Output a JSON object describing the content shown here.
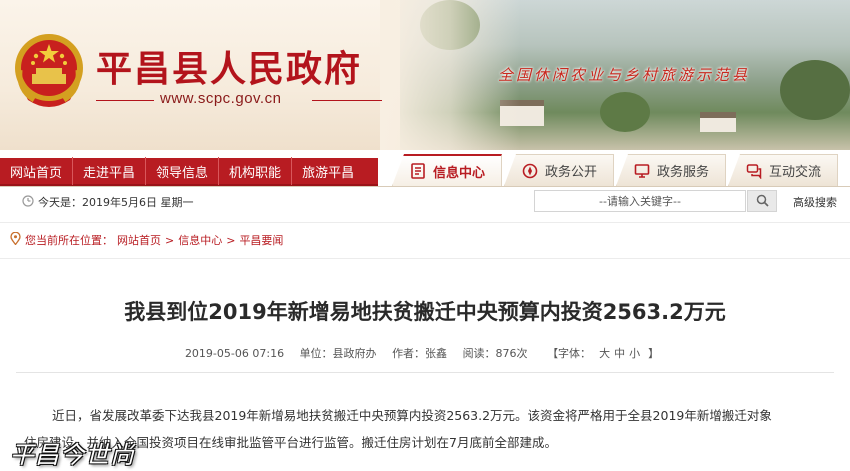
{
  "site": {
    "title": "平昌县人民政府",
    "url": "www.scpc.gov.cn",
    "slogan": "全国休闲农业与乡村旅游示范县"
  },
  "nav": {
    "items": [
      {
        "label": "网站首页"
      },
      {
        "label": "走进平昌"
      },
      {
        "label": "领导信息"
      },
      {
        "label": "机构职能"
      },
      {
        "label": "旅游平昌"
      }
    ],
    "tabs": [
      {
        "label": "信息中心",
        "icon": "document-icon",
        "active": true
      },
      {
        "label": "政务公开",
        "icon": "compass-icon",
        "active": false
      },
      {
        "label": "政务服务",
        "icon": "monitor-icon",
        "active": false
      },
      {
        "label": "互动交流",
        "icon": "chat-icon",
        "active": false
      }
    ]
  },
  "infobar": {
    "date": "今天是：2019年5月6日 星期一",
    "search_placeholder": "--请输入关键字--",
    "advanced_search": "高级搜索"
  },
  "breadcrumb": {
    "prefix": "您当前所在位置：",
    "items": [
      "网站首页",
      "信息中心",
      "平昌要闻"
    ],
    "separator": ">"
  },
  "article": {
    "title": "我县到位2019年新增易地扶贫搬迁中央预算内投资2563.2万元",
    "date": "2019-05-06 07:16",
    "unit": "单位：县政府办",
    "author": "作者：张鑫",
    "views": "阅读：876次",
    "font_label": "【字体：",
    "font_large": "大",
    "font_medium": "中",
    "font_small": "小",
    "font_close": "】",
    "paragraph1": "近日，省发展改革委下达我县2019年新增易地扶贫搬迁中央预算内投资2563.2万元。该资金将严格用于全县2019年新增搬迁对象",
    "paragraph2": "住房建设，并纳入全国投资项目在线审批监管平台进行监管。搬迁住房计划在7月底前全部建成。"
  },
  "watermark": "平昌今世尚",
  "colors": {
    "brand_red": "#b81c22",
    "title_red": "#b3141c",
    "banner_bg": "#f6ebdc"
  }
}
